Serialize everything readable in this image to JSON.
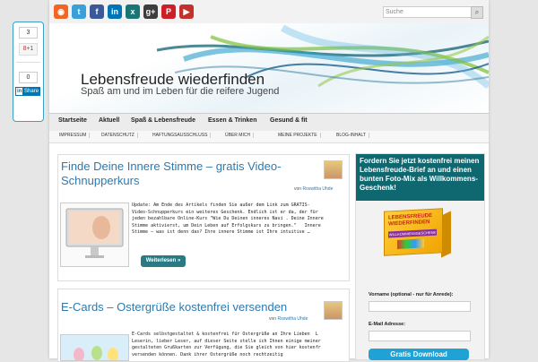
{
  "share": {
    "gplus_count": "3",
    "gplus_label": "8+1",
    "linkedin_count": "0",
    "linkedin_brand": "in",
    "linkedin_label": "Share"
  },
  "topbar": {
    "social_icons": [
      {
        "name": "rss-icon",
        "glyph": "◉",
        "color": "#f26522"
      },
      {
        "name": "twitter-icon",
        "glyph": "t",
        "color": "#3aa0d8"
      },
      {
        "name": "facebook-icon",
        "glyph": "f",
        "color": "#3b5998"
      },
      {
        "name": "linkedin-icon",
        "glyph": "in",
        "color": "#0077b5"
      },
      {
        "name": "xing-icon",
        "glyph": "x",
        "color": "#1a7576"
      },
      {
        "name": "googleplus-icon",
        "glyph": "g+",
        "color": "#3d3d3d"
      },
      {
        "name": "pinterest-icon",
        "glyph": "P",
        "color": "#cb2027"
      },
      {
        "name": "youtube-icon",
        "glyph": "▶",
        "color": "#c4302b"
      }
    ],
    "search_placeholder": "Suche"
  },
  "header": {
    "title": "Lebensfreude wiederfinden",
    "tagline": "Spaß am und im Leben für die reifere Jugend"
  },
  "nav": {
    "items": [
      "Startseite",
      "Aktuell",
      "Spaß & Lebensfreude",
      "Essen & Trinken",
      "Gesund & fit"
    ]
  },
  "subnav": {
    "items": [
      "IMPRESSUM",
      "DATENSCHUTZ",
      "HAFTUNGSAUSSCHLUSS",
      "ÜBER MICH",
      "MEINE PROJEKTE",
      "BLOG-INHALT"
    ]
  },
  "posts": [
    {
      "title_line1": "Finde Deine Innere Stimme – gratis Video-",
      "title_line2": "Schnupperkurs",
      "by": "von",
      "author": "Roswitha Uhde",
      "excerpt": "Update: Am Ende des Artikels finden Sie außer dem Link zum GRATIS-\nVideo-Schnupperkurs ein weiteres Geschenk. Endlich ist er da, der für\njeden bezahlbare Online-Kurs \"Wie Du Deinen inneres Navi . Deine Innere\nStimme aktivierst, um Dein Leben auf Erfolgskurs zu bringen.\"   Innere\nStimme – was ist denn das? Ihre innere Stimme ist Ihre intuitive …",
      "read_more": "Weiterlesen »"
    },
    {
      "title": "E-Cards – Ostergrüße kostenfrei versenden",
      "by": "von",
      "author": "Roswitha Uhde",
      "excerpt": "E-Cards selbstgestaltet & kostenfrei für Ostergrüße an Ihre Lieben  L\nLeserin, lieber Leser, auf dieser Seite stelle ich Ihnen einige meiner\ngestalteten Grußkarten zur Verfügung, die Sie gleich von hier kostenfr\nversenden können. Dank ihrer Ostergrüße noch rechtzeitig"
    }
  ],
  "sidebar": {
    "promo": "Fordern Sie jetzt kostenfrei meinen Lebensfreude-Brief an und einen bunten Foto-Mix als Willkommens-Geschenk!",
    "box_title_1": "LEBENSFREUDE",
    "box_title_2": "WIEDERFINDEN",
    "box_sub": "WILLKOMMENSGESCHENK",
    "name_label": "Vorname (optional - nur für Anrede):",
    "email_label": "E-Mail Adresse:",
    "download_btn": "Gratis Download"
  }
}
